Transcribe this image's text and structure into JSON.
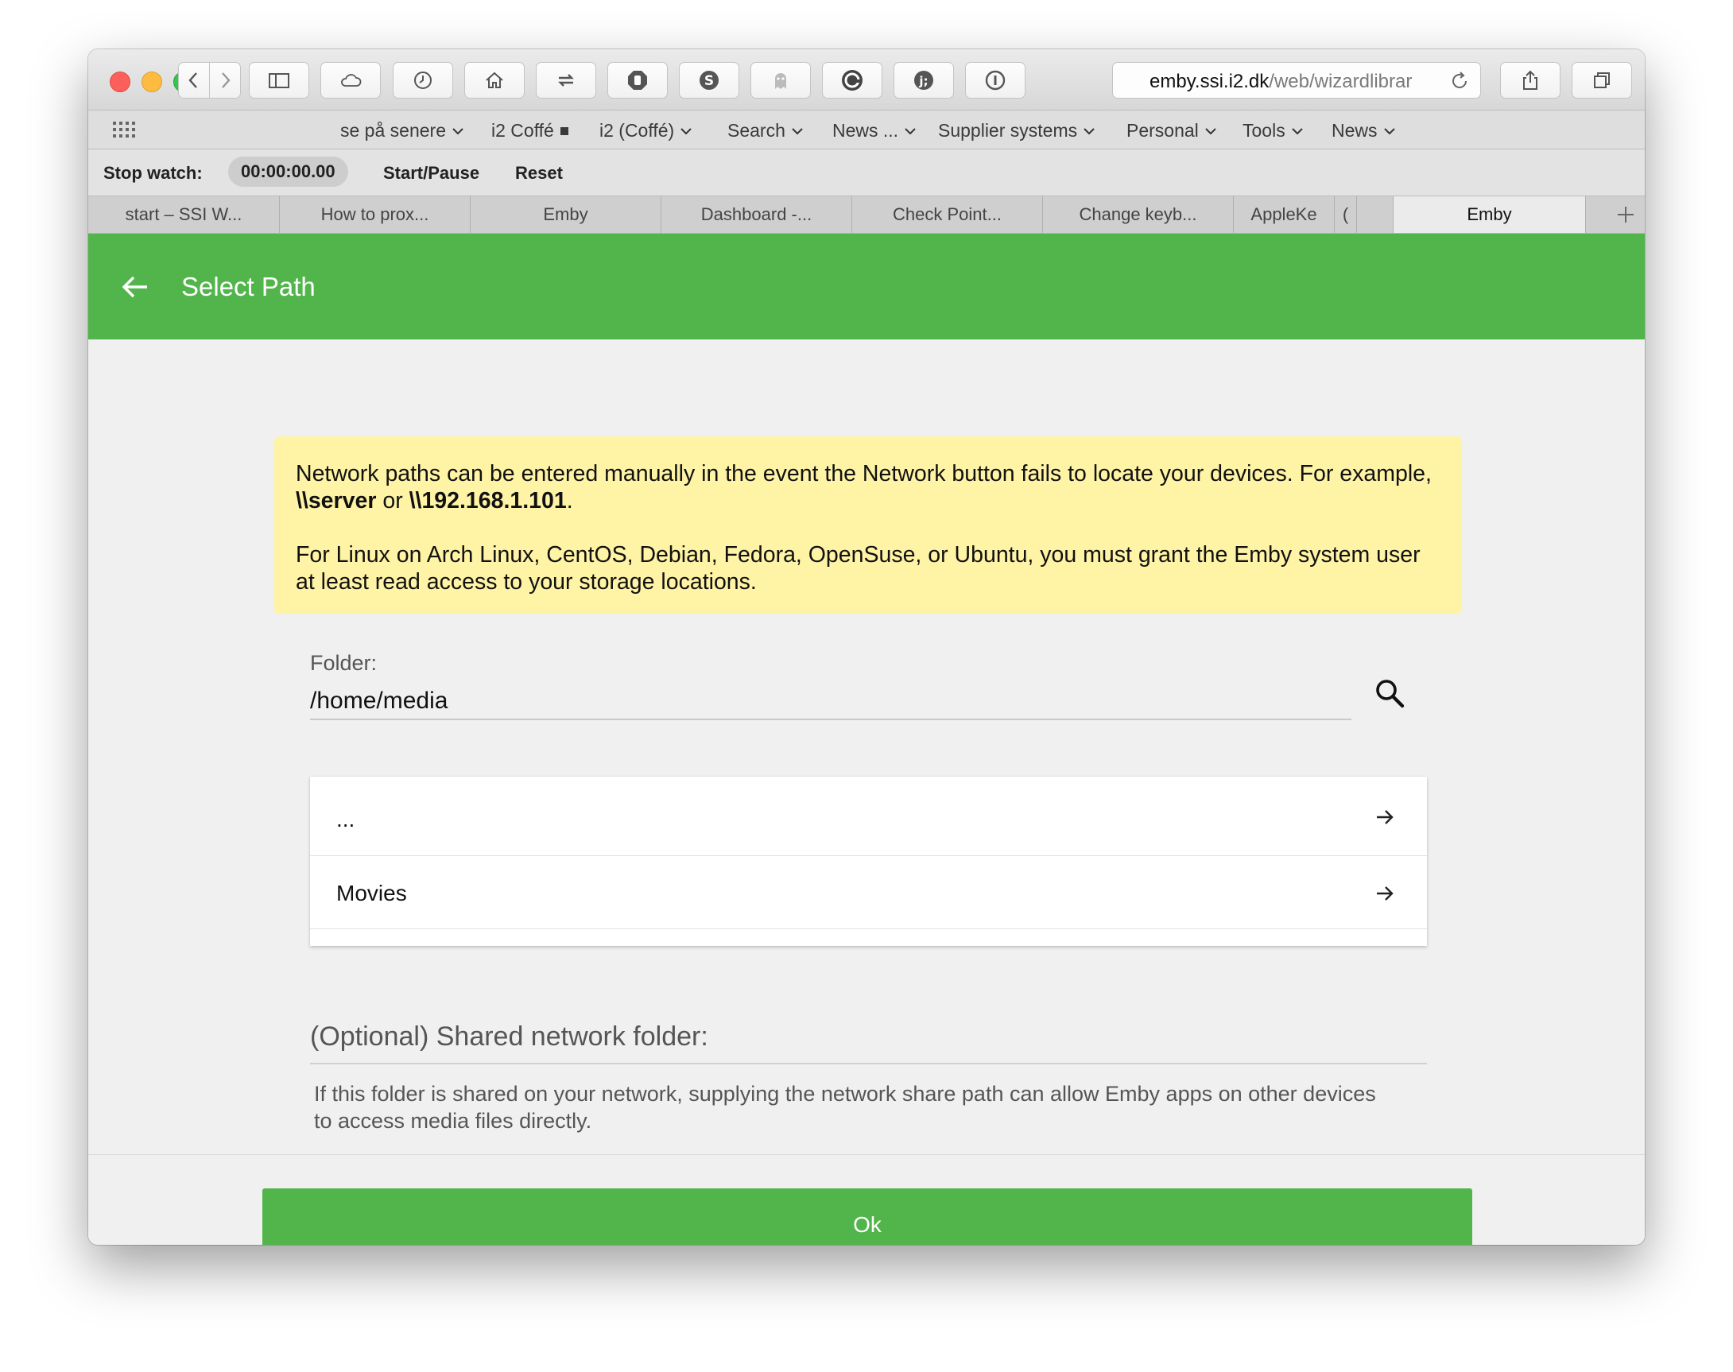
{
  "browser": {
    "url_host": "emby.ssi.i2.dk",
    "url_path": "/web/wizardlibrar",
    "bookmarks": [
      {
        "label": "se på senere",
        "menu": true
      },
      {
        "label": "i2 Coffé",
        "menu": false
      },
      {
        "label": "i2 (Coffé)",
        "menu": true
      },
      {
        "label": "Search",
        "menu": true
      },
      {
        "label": "News ...",
        "menu": true
      },
      {
        "label": "Supplier systems",
        "menu": true
      },
      {
        "label": "Personal",
        "menu": true
      },
      {
        "label": "Tools",
        "menu": true
      },
      {
        "label": "News",
        "menu": true
      }
    ],
    "stopwatch": {
      "label": "Stop watch:",
      "time": "00:00:00.00",
      "start_pause": "Start/Pause",
      "reset": "Reset"
    },
    "tabs": [
      {
        "label": "start – SSI W..."
      },
      {
        "label": "How to prox..."
      },
      {
        "label": "Emby"
      },
      {
        "label": "Dashboard -..."
      },
      {
        "label": "Check Point..."
      },
      {
        "label": "Change keyb..."
      },
      {
        "label": "AppleKe"
      },
      {
        "label": "("
      },
      {
        "label": ""
      },
      {
        "label": "Emby",
        "active": true
      }
    ]
  },
  "page": {
    "title": "Select Path",
    "notice": {
      "line1_pre": "Network paths can be entered manually in the event the Network button fails to locate your devices. For example, ",
      "example1": "\\\\server",
      "or": " or ",
      "example2": "\\\\192.168.1.101",
      "line1_post": ".",
      "line2": "For Linux on Arch Linux, CentOS, Debian, Fedora, OpenSuse, or Ubuntu, you must grant the Emby system user at least read access to your storage locations."
    },
    "folder": {
      "label": "Folder:",
      "value": "/home/media"
    },
    "list": [
      {
        "label": "..."
      },
      {
        "label": "Movies"
      }
    ],
    "shared": {
      "label": "(Optional) Shared network folder:",
      "description": "If this folder is shared on your network, supplying the network share path can allow Emby apps on other devices to access media files directly."
    },
    "ok_label": "Ok"
  },
  "colors": {
    "accent_green": "#52b54b",
    "notice_yellow": "#fff3a5"
  },
  "icons": {
    "toolbar": [
      "chevron-left-icon",
      "chevron-right-icon",
      "sidebar-icon",
      "cloud-icon",
      "history-icon",
      "home-icon",
      "transfer-icon",
      "stop-hand-icon",
      "skype-icon",
      "ghost-icon",
      "spiral-icon",
      "jscript-icon",
      "password-icon",
      "share-icon",
      "tabs-overview-icon"
    ]
  }
}
